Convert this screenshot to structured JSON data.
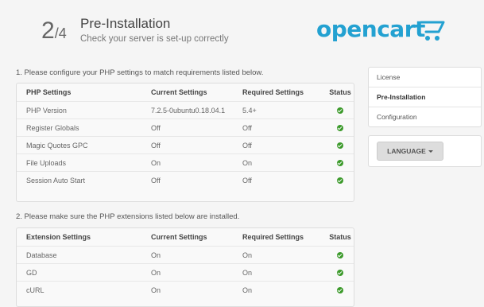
{
  "header": {
    "step_current": "2",
    "step_total": "4",
    "title": "Pre-Installation",
    "subtitle": "Check your server is set-up correctly"
  },
  "logo": {
    "text": "opencart",
    "color": "#23a1d1"
  },
  "section1": {
    "label": "1. Please configure your PHP settings to match requirements listed below.",
    "headers": [
      "PHP Settings",
      "Current Settings",
      "Required Settings",
      "Status"
    ],
    "rows": [
      {
        "name": "PHP Version",
        "current": "7.2.5-0ubuntu0.18.04.1",
        "required": "5.4+",
        "status": "ok"
      },
      {
        "name": "Register Globals",
        "current": "Off",
        "required": "Off",
        "status": "ok"
      },
      {
        "name": "Magic Quotes GPC",
        "current": "Off",
        "required": "Off",
        "status": "ok"
      },
      {
        "name": "File Uploads",
        "current": "On",
        "required": "On",
        "status": "ok"
      },
      {
        "name": "Session Auto Start",
        "current": "Off",
        "required": "Off",
        "status": "ok"
      }
    ]
  },
  "section2": {
    "label": "2. Please make sure the PHP extensions listed below are installed.",
    "headers": [
      "Extension Settings",
      "Current Settings",
      "Required Settings",
      "Status"
    ],
    "rows": [
      {
        "name": "Database",
        "current": "On",
        "required": "On",
        "status": "ok"
      },
      {
        "name": "GD",
        "current": "On",
        "required": "On",
        "status": "ok"
      },
      {
        "name": "cURL",
        "current": "On",
        "required": "On",
        "status": "ok"
      }
    ]
  },
  "sidebar": {
    "items": [
      {
        "label": "License",
        "active": false
      },
      {
        "label": "Pre-Installation",
        "active": true
      },
      {
        "label": "Configuration",
        "active": false
      }
    ]
  },
  "language": {
    "button_label": "LANGUAGE"
  },
  "colors": {
    "status_ok": "#3c9a2b",
    "brand": "#23a1d1"
  }
}
